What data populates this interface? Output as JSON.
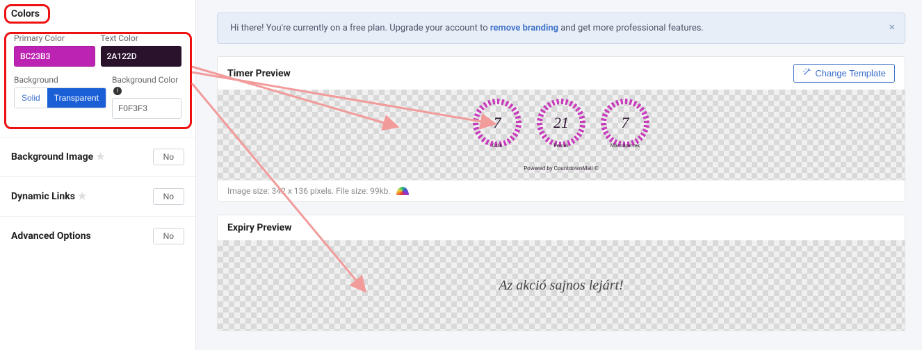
{
  "sidebar": {
    "colors_title": "Colors",
    "primary_label": "Primary Color",
    "primary_value": "BC23B3",
    "text_label": "Text Color",
    "text_value": "2A122D",
    "bg_label": "Background",
    "bg_color_label": "Background Color",
    "bg_solid": "Solid",
    "bg_transparent": "Transparent",
    "bg_color_value": "F0F3F3",
    "background_image": "Background Image",
    "dynamic_links": "Dynamic Links",
    "advanced_options": "Advanced Options",
    "no": "No"
  },
  "alert": {
    "pre": "Hi there! You're currently on a free plan. Upgrade your account to ",
    "link": "remove branding",
    "post": " and get more professional features."
  },
  "timer": {
    "title": "Timer Preview",
    "change_template": "Change Template",
    "nums": [
      "7",
      "21",
      "7"
    ],
    "labels": [
      "Órák",
      "Percek",
      "Másodpercek"
    ],
    "powered": "Powered by CountdownMail ©",
    "meta": "Image size: 342 x 136 pixels. File size: 99kb."
  },
  "expiry": {
    "title": "Expiry Preview",
    "text": "Az akció sajnos lejárt!"
  }
}
